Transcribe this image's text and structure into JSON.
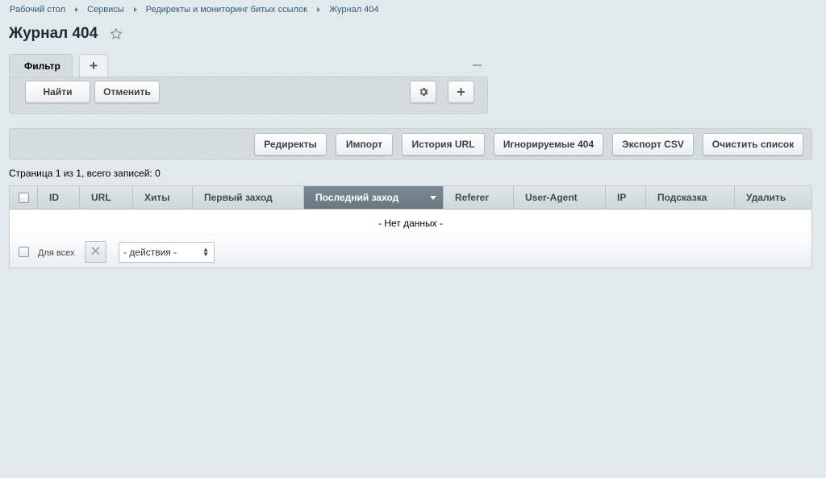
{
  "breadcrumbs": [
    "Рабочий стол",
    "Сервисы",
    "Редиректы и мониторинг битых ссылок",
    "Журнал 404"
  ],
  "page": {
    "title": "Журнал 404"
  },
  "filter": {
    "tab_label": "Фильтр",
    "add_tab": "+",
    "find_label": "Найти",
    "cancel_label": "Отменить",
    "add_label": "+"
  },
  "toolbar": {
    "buttons": [
      "Редиректы",
      "Импорт",
      "История URL",
      "Игнорируемые 404",
      "Экспорт CSV",
      "Очистить список"
    ]
  },
  "grid": {
    "page_info": "Страница 1 из 1, всего записей: 0",
    "columns": [
      "ID",
      "URL",
      "Хиты",
      "Первый заход",
      "Последний заход",
      "Referer",
      "User-Agent",
      "IP",
      "Подсказка",
      "Удалить"
    ],
    "sorted_column": "Последний заход",
    "empty_text": "- Нет данных -",
    "footer": {
      "for_all_label": "Для всех",
      "delete_symbol": "✕",
      "actions_value": "- действия -"
    }
  },
  "colors": {
    "background": "#e2e9ec",
    "sorted_header": "#7c8a94",
    "link": "#2f5b7a"
  },
  "icons": [
    "star-icon",
    "gear-icon",
    "plus-icon",
    "close-icon",
    "sort-down-icon"
  ]
}
